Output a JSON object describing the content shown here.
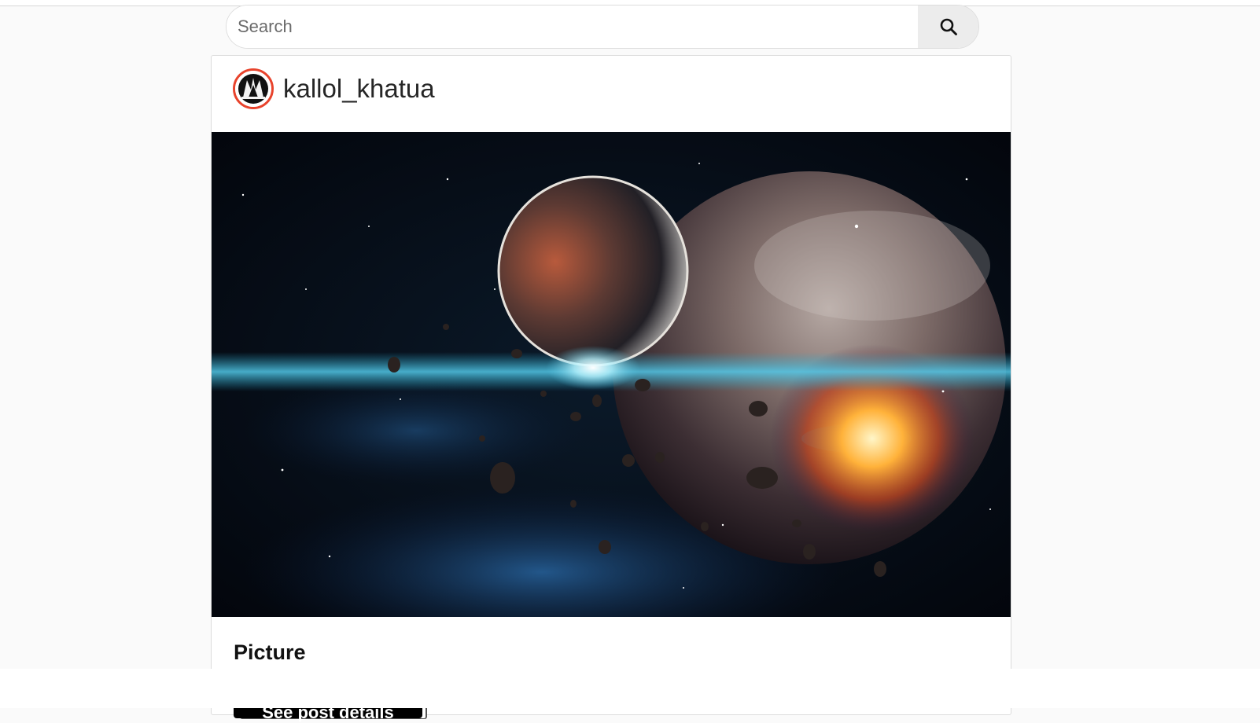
{
  "search": {
    "placeholder": "Search",
    "button_icon": "search-icon"
  },
  "post": {
    "username": "kallol_khatua",
    "avatar_icon": "avatar-icon",
    "image_alt": "space scene with planets and asteroids",
    "caption_title": "Picture",
    "details_button_label": "See post details"
  },
  "colors": {
    "avatar_ring": "#e8432c",
    "button_bg": "#000000"
  }
}
